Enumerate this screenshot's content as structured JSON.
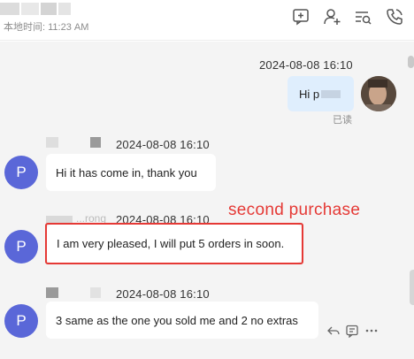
{
  "header": {
    "local_time": "本地时间: 11:23 AM",
    "icons": [
      "message-add-icon",
      "add-user-icon",
      "search-list-icon",
      "phone-icon"
    ]
  },
  "messages": [
    {
      "direction": "outgoing",
      "timestamp": "2024-08-08 16:10",
      "text": "Hi p",
      "status": "已读"
    },
    {
      "direction": "incoming",
      "avatar": "P",
      "timestamp": "2024-08-08 16:10",
      "text": "Hi it has come in, thank you"
    },
    {
      "direction": "incoming",
      "avatar": "P",
      "sender": "...rong",
      "timestamp": "2024-08-08 16:10",
      "text": "I am very pleased, I will put 5 orders in soon."
    },
    {
      "direction": "incoming",
      "avatar": "P",
      "timestamp": "2024-08-08 16:10",
      "text": "3 same as the one you sold me and 2 no extras"
    }
  ],
  "annotation": {
    "text": "second purchase",
    "color": "#e53935"
  },
  "message_actions": [
    "reply-icon",
    "quote-icon",
    "more-icon"
  ],
  "colors": {
    "avatar": "#5a67d8",
    "outgoing_bubble": "#dfeefd",
    "chat_background": "#f4f4f4"
  }
}
